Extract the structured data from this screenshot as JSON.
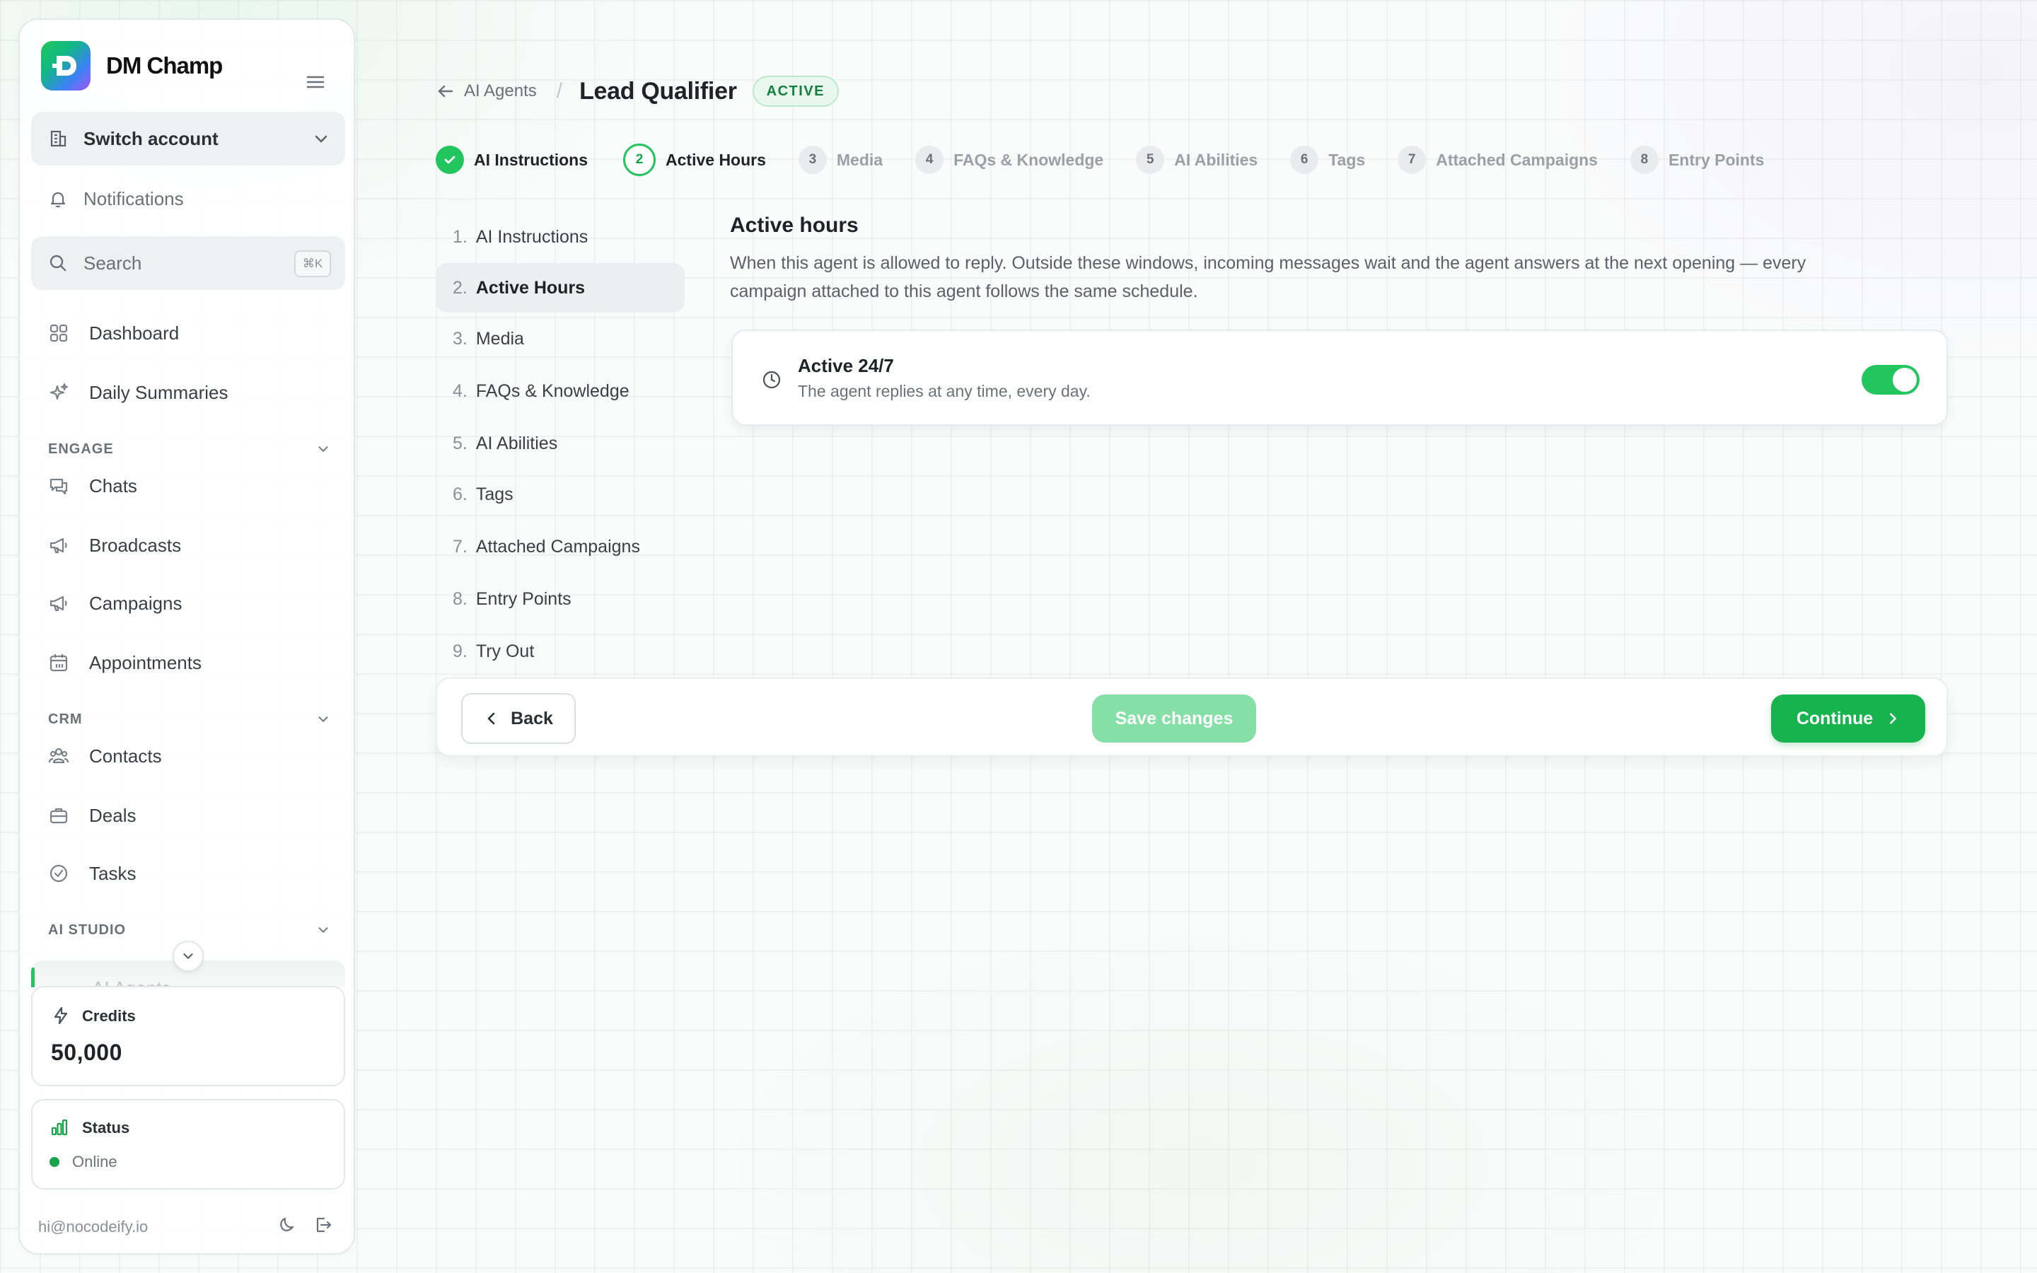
{
  "brand": {
    "name": "DM Champ"
  },
  "sidebar": {
    "switch_account": "Switch account",
    "notifications": "Notifications",
    "search": {
      "label": "Search",
      "shortcut": "⌘K"
    },
    "top_items": [
      {
        "label": "Dashboard",
        "icon": "grid-icon"
      },
      {
        "label": "Daily Summaries",
        "icon": "sparkles-icon"
      }
    ],
    "engage": {
      "header": "ENGAGE",
      "items": [
        {
          "label": "Chats",
          "icon": "chat-icon"
        },
        {
          "label": "Broadcasts",
          "icon": "megaphone-icon"
        },
        {
          "label": "Campaigns",
          "icon": "megaphone-icon"
        },
        {
          "label": "Appointments",
          "icon": "calendar-icon"
        }
      ]
    },
    "crm": {
      "header": "CRM",
      "items": [
        {
          "label": "Contacts",
          "icon": "users-icon"
        },
        {
          "label": "Deals",
          "icon": "briefcase-icon"
        },
        {
          "label": "Tasks",
          "icon": "check-circle-icon"
        }
      ]
    },
    "ai_studio": {
      "header": "AI STUDIO",
      "items": [
        {
          "label": "AI Agents"
        }
      ]
    },
    "credits": {
      "title": "Credits",
      "value": "50,000"
    },
    "status": {
      "title": "Status",
      "value": "Online"
    },
    "footer_email": "hi@nocodeify.io"
  },
  "breadcrumb": {
    "back_label": "AI Agents",
    "separator": "/",
    "title": "Lead Qualifier",
    "badge": "ACTIVE"
  },
  "stepper": [
    {
      "num": "1",
      "label": "AI Instructions",
      "state": "done"
    },
    {
      "num": "2",
      "label": "Active Hours",
      "state": "current"
    },
    {
      "num": "3",
      "label": "Media",
      "state": "upcoming"
    },
    {
      "num": "4",
      "label": "FAQs & Knowledge",
      "state": "upcoming"
    },
    {
      "num": "5",
      "label": "AI Abilities",
      "state": "upcoming"
    },
    {
      "num": "6",
      "label": "Tags",
      "state": "upcoming"
    },
    {
      "num": "7",
      "label": "Attached Campaigns",
      "state": "upcoming"
    },
    {
      "num": "8",
      "label": "Entry Points",
      "state": "upcoming"
    }
  ],
  "steps_list": [
    {
      "num": "1.",
      "label": "AI Instructions"
    },
    {
      "num": "2.",
      "label": "Active Hours",
      "selected": true
    },
    {
      "num": "3.",
      "label": "Media"
    },
    {
      "num": "4.",
      "label": "FAQs & Knowledge"
    },
    {
      "num": "5.",
      "label": "AI Abilities"
    },
    {
      "num": "6.",
      "label": "Tags"
    },
    {
      "num": "7.",
      "label": "Attached Campaigns"
    },
    {
      "num": "8.",
      "label": "Entry Points"
    },
    {
      "num": "9.",
      "label": "Try Out"
    }
  ],
  "active_hours": {
    "title": "Active hours",
    "description": "When this agent is allowed to reply. Outside these windows, incoming messages wait and the agent answers at the next opening — every campaign attached to this agent follows the same schedule.",
    "option": {
      "title": "Active 24/7",
      "subtitle": "The agent replies at any time, every day.",
      "enabled": true
    }
  },
  "actions": {
    "back": "Back",
    "save": "Save changes",
    "continue": "Continue"
  },
  "colors": {
    "accent": "#22c55e",
    "accent_dark": "#16b34f",
    "save_disabled": "#86dfa7",
    "badge_text": "#15803d"
  }
}
